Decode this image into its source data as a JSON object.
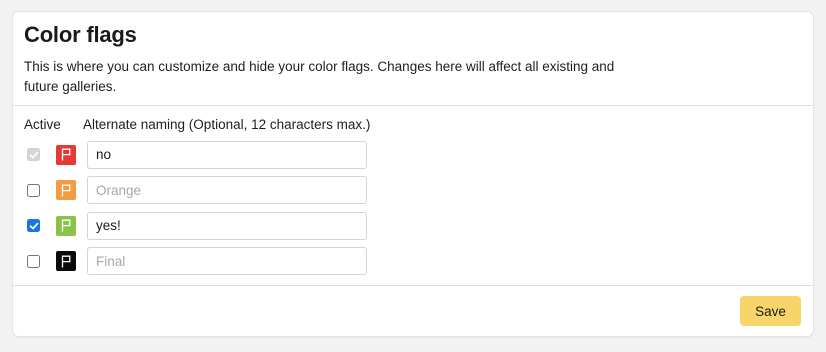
{
  "panel": {
    "title": "Color flags",
    "description": "This is where you can customize and hide your color flags. Changes here will affect all existing and future galleries."
  },
  "columns": {
    "active": "Active",
    "alternate_naming": "Alternate naming (Optional, 12 characters max.)"
  },
  "flags": [
    {
      "color_name": "red",
      "color": "#e53935",
      "icon": "flag-icon",
      "active": true,
      "disabled": true,
      "value": "no",
      "placeholder": ""
    },
    {
      "color_name": "orange",
      "color": "#f39a45",
      "icon": "flag-icon",
      "active": false,
      "disabled": false,
      "value": "",
      "placeholder": "Orange"
    },
    {
      "color_name": "green",
      "color": "#8bc34a",
      "icon": "flag-icon",
      "active": true,
      "disabled": false,
      "value": "yes!",
      "placeholder": ""
    },
    {
      "color_name": "black",
      "color": "#0a0a0a",
      "icon": "flag-icon",
      "active": false,
      "disabled": false,
      "value": "",
      "placeholder": "Final"
    }
  ],
  "footer": {
    "save_label": "Save",
    "save_color": "#f8d56a"
  }
}
